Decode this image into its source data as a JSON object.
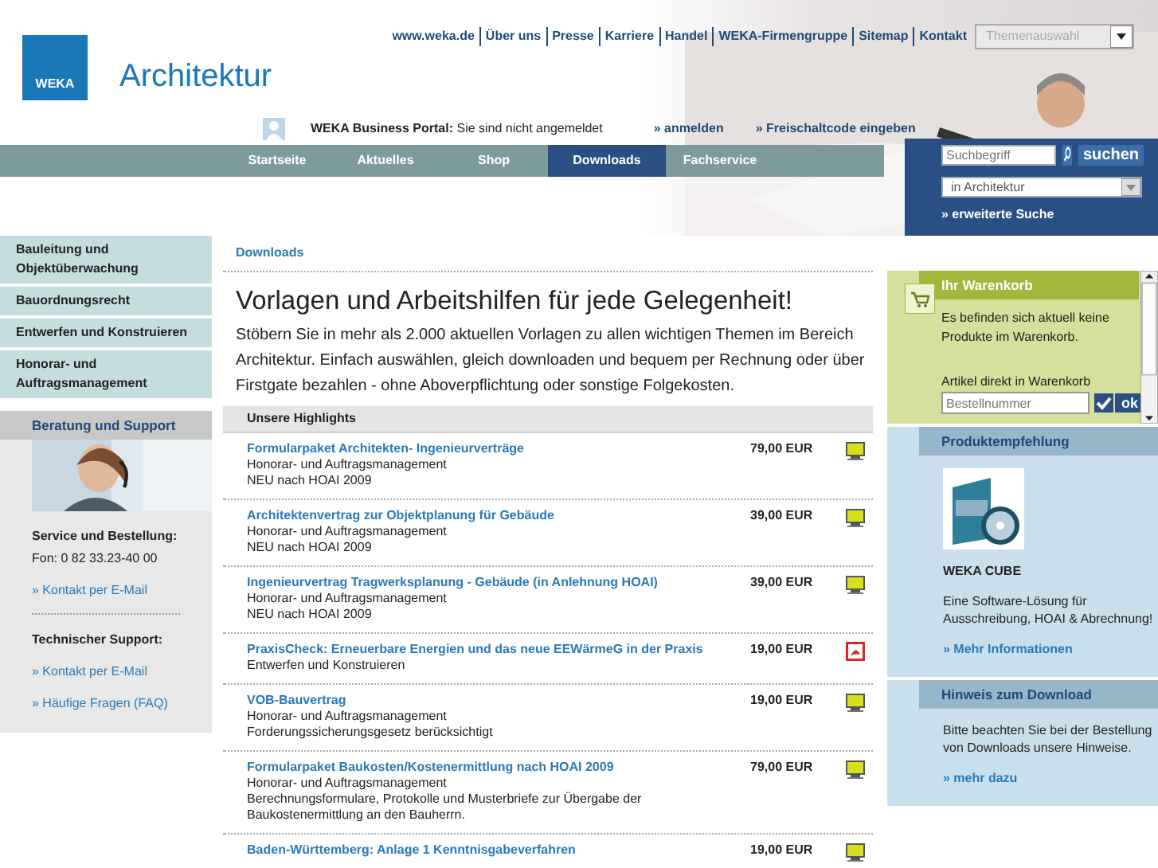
{
  "header": {
    "logo_text": "WEKA",
    "site_title": "Architektur",
    "top_links": [
      "www.weka.de",
      "Über uns",
      "Presse",
      "Karriere",
      "Handel",
      "WEKA-Firmengruppe",
      "Sitemap",
      "Kontakt"
    ],
    "theme_select": {
      "value": "Themenauswahl"
    }
  },
  "portal_bar": {
    "label": "WEKA Business Portal:",
    "status": "Sie sind nicht angemeldet",
    "links": [
      "» anmelden",
      "» Freischaltcode eingeben"
    ]
  },
  "nav": {
    "tabs": [
      {
        "label": "Startseite",
        "selected": false
      },
      {
        "label": "Aktuelles",
        "selected": false
      },
      {
        "label": "Shop",
        "selected": false
      },
      {
        "label": "Downloads",
        "selected": true
      },
      {
        "label": "Fachservice",
        "selected": false
      }
    ]
  },
  "search": {
    "placeholder": "Suchbegriff",
    "button": "suchen",
    "scope": "in Architektur",
    "advanced_link": "» erweiterte Suche"
  },
  "sidebar": {
    "items": [
      "Bauleitung und Objektüberwachung",
      "Bauordnungsrecht",
      "Entwerfen und Konstruieren",
      "Honorar- und Auftragsmanagement"
    ],
    "support": {
      "title": "Beratung und Support",
      "blocks": [
        {
          "kind": "heading",
          "text": "Service und Bestellung:"
        },
        {
          "kind": "text",
          "text": "Fon: 0 82 33.23-40 00"
        },
        {
          "kind": "link",
          "text": "» Kontakt per E-Mail"
        },
        {
          "kind": "divider"
        },
        {
          "kind": "heading",
          "text": "Technischer Support:"
        },
        {
          "kind": "link",
          "text": "» Kontakt per E-Mail"
        },
        {
          "kind": "link",
          "text": "» Häufige Fragen (FAQ)"
        }
      ]
    }
  },
  "main": {
    "breadcrumb": "Downloads",
    "title": "Vorlagen und Arbeitshilfen für jede Gelegenheit!",
    "intro": "Stöbern Sie in mehr als 2.000 aktuellen Vorlagen zu allen wichtigen Themen im Bereich Architektur. Einfach auswählen, gleich downloaden und bequem per Rechnung oder über Firstgate bezahlen - ohne Aboverpflichtung oder sonstige Folgekosten.",
    "highlights_title": "Unsere Highlights",
    "items": [
      {
        "title": "Formularpaket Architekten- Ingenieurverträge",
        "lines": [
          "Honorar- und Auftragsmanagement",
          "NEU nach HOAI 2009"
        ],
        "price": "79,00 EUR",
        "kind": "doc"
      },
      {
        "title": "Architektenvertrag zur Objektplanung für Gebäude",
        "lines": [
          "Honorar- und Auftragsmanagement",
          "NEU nach HOAI 2009"
        ],
        "price": "39,00 EUR",
        "kind": "doc"
      },
      {
        "title": "Ingenieurvertrag Tragwerksplanung - Gebäude (in Anlehnung HOAI)",
        "lines": [
          "Honorar- und Auftragsmanagement",
          "NEU nach HOAI 2009"
        ],
        "price": "39,00 EUR",
        "kind": "doc"
      },
      {
        "title": "PraxisCheck: Erneuerbare Energien und das neue EEWärmeG in der Praxis",
        "lines": [
          "Entwerfen und Konstruieren"
        ],
        "price": "19,00 EUR",
        "kind": "pdf"
      },
      {
        "title": "VOB-Bauvertrag",
        "lines": [
          "Honorar- und Auftragsmanagement",
          "Forderungssicherungsgesetz berücksichtigt"
        ],
        "price": "19,00 EUR",
        "kind": "doc"
      },
      {
        "title": "Formularpaket Baukosten/Kostenermittlung nach HOAI 2009",
        "lines": [
          "Honorar- und Auftragsmanagement",
          "Berechnungsformulare, Protokolle und Musterbriefe zur Übergabe der Baukostenermittlung an den Bauherrn."
        ],
        "price": "79,00 EUR",
        "kind": "doc"
      },
      {
        "title": "Baden-Württemberg: Anlage 1 Kenntnisgabeverfahren",
        "price": "19,00 EUR",
        "kind": "doc"
      }
    ]
  },
  "cart": {
    "title": "Ihr Warenkorb",
    "message": "Es befinden sich aktuell keine Produkte im Warenkorb.",
    "direct_label": "Artikel direkt in Warenkorb",
    "order_placeholder": "Bestellnummer",
    "ok_button": "ok"
  },
  "product": {
    "title": "Produktempfehlung",
    "name": "WEKA CUBE",
    "description": "Eine Software-Lösung für Ausschreibung, HOAI & Abrechnung!",
    "link": "» Mehr Informationen"
  },
  "hint": {
    "title": "Hinweis zum Download",
    "text": "Bitte beachten Sie bei der Bestellung von Downloads unsere Hinweise.",
    "link": "» mehr dazu"
  }
}
